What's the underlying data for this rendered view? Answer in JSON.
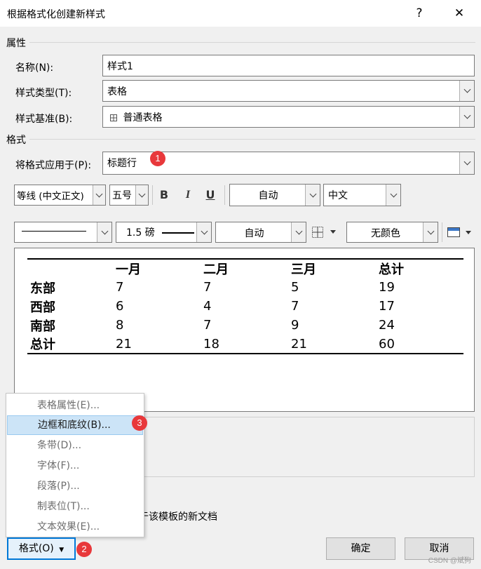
{
  "dialog": {
    "title": "根据格式化创建新样式",
    "help_label": "?",
    "close_label": "✕"
  },
  "properties": {
    "section_label": "属性",
    "name_label": "名称(N):",
    "name_value": "样式1",
    "type_label": "样式类型(T):",
    "type_value": "表格",
    "base_label": "样式基准(B):",
    "base_value": "普通表格",
    "base_icon": "table-grid-icon"
  },
  "format": {
    "section_label": "格式",
    "apply_to_label": "将格式应用于(P):",
    "apply_to_value": "标题行",
    "font_value": "等线 (中文正文)",
    "size_value": "五号",
    "bold_label": "B",
    "italic_label": "I",
    "underline_label": "U",
    "color_value": "自动",
    "script_value": "中文",
    "line_weight_value": "1.5 磅",
    "border_color_value": "自动",
    "shading_value": "无颜色"
  },
  "preview_table": {
    "headers": [
      "",
      "一月",
      "二月",
      "三月",
      "总计"
    ],
    "rows": [
      [
        "东部",
        "7",
        "7",
        "5",
        "19"
      ],
      [
        "西部",
        "6",
        "4",
        "7",
        "17"
      ],
      [
        "南部",
        "8",
        "7",
        "9",
        "24"
      ],
      [
        "总计",
        "21",
        "18",
        "21",
        "60"
      ]
    ]
  },
  "context_menu": {
    "items": [
      {
        "label": "表格属性(E)..."
      },
      {
        "label": "边框和底纹(B)..."
      },
      {
        "label": "条带(D)..."
      },
      {
        "label": "字体(F)..."
      },
      {
        "label": "段落(P)..."
      },
      {
        "label": "制表位(T)..."
      },
      {
        "label": "文本效果(E)..."
      }
    ],
    "highlighted_index": 1
  },
  "template_text": "于该模板的新文档",
  "buttons": {
    "format_label": "格式(O)",
    "ok_label": "确定",
    "cancel_label": "取消"
  },
  "badges": {
    "b1": "1",
    "b2": "2",
    "b3": "3"
  },
  "watermark": "CSDN @斌狗",
  "colors": {
    "badge": "#e8383b",
    "highlight": "#cce4f7",
    "focus": "#0078d7"
  }
}
